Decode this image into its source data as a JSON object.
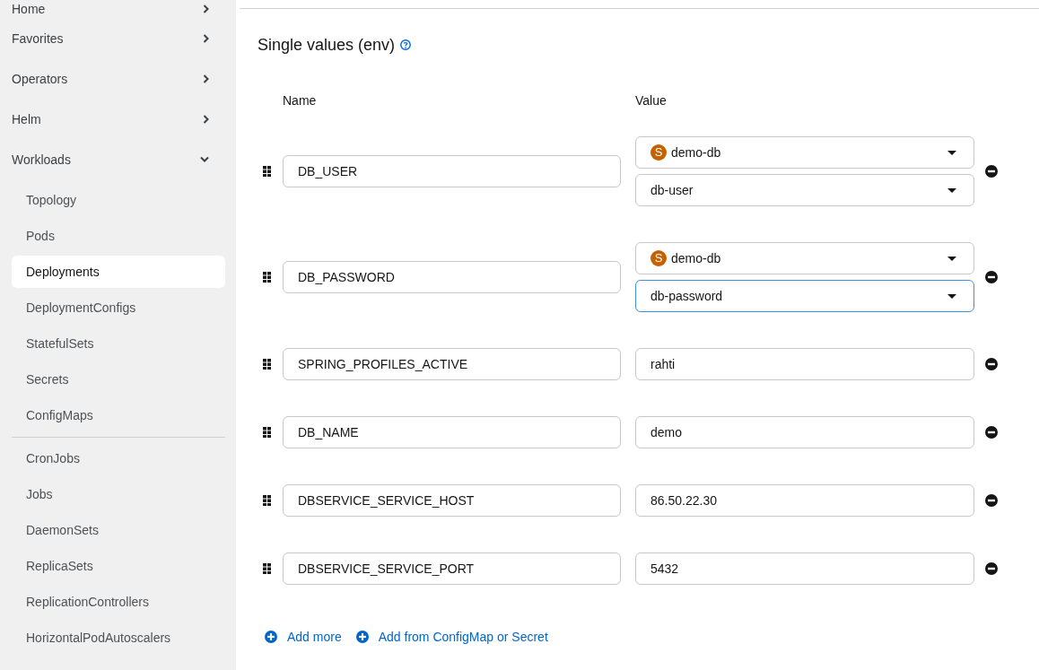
{
  "sidebar": {
    "items": [
      {
        "label": "Home",
        "expanded": false
      },
      {
        "label": "Favorites",
        "expanded": false
      },
      {
        "label": "Operators",
        "expanded": false
      },
      {
        "label": "Helm",
        "expanded": false
      },
      {
        "label": "Workloads",
        "expanded": true,
        "children": [
          {
            "kind": "link",
            "label": "Topology",
            "selected": false
          },
          {
            "kind": "link",
            "label": "Pods",
            "selected": false
          },
          {
            "kind": "link",
            "label": "Deployments",
            "selected": true
          },
          {
            "kind": "link",
            "label": "DeploymentConfigs",
            "selected": false
          },
          {
            "kind": "link",
            "label": "StatefulSets",
            "selected": false
          },
          {
            "kind": "link",
            "label": "Secrets",
            "selected": false
          },
          {
            "kind": "link",
            "label": "ConfigMaps",
            "selected": false
          },
          {
            "kind": "divider"
          },
          {
            "kind": "link",
            "label": "CronJobs",
            "selected": false
          },
          {
            "kind": "link",
            "label": "Jobs",
            "selected": false
          },
          {
            "kind": "link",
            "label": "DaemonSets",
            "selected": false
          },
          {
            "kind": "link",
            "label": "ReplicaSets",
            "selected": false
          },
          {
            "kind": "link",
            "label": "ReplicationControllers",
            "selected": false
          },
          {
            "kind": "link",
            "label": "HorizontalPodAutoscalers",
            "selected": false
          }
        ]
      }
    ]
  },
  "env_section": {
    "title": "Single values (env)",
    "columns": [
      "Name",
      "Value"
    ],
    "rows": [
      {
        "name": "DB_USER",
        "value": {
          "kind": "reference",
          "resource": {
            "badge": "S",
            "label": "demo-db",
            "focused": false
          },
          "key": {
            "label": "db-user",
            "focused": false
          }
        }
      },
      {
        "name": "DB_PASSWORD",
        "value": {
          "kind": "reference",
          "resource": {
            "badge": "S",
            "label": "demo-db",
            "focused": false
          },
          "key": {
            "label": "db-password",
            "focused": true
          }
        }
      },
      {
        "name": "SPRING_PROFILES_ACTIVE",
        "value": {
          "kind": "text",
          "text": "rahti"
        }
      },
      {
        "name": "DB_NAME",
        "value": {
          "kind": "text",
          "text": "demo"
        }
      },
      {
        "name": "DBSERVICE_SERVICE_HOST",
        "value": {
          "kind": "text",
          "text": "86.50.22.30"
        }
      },
      {
        "name": "DBSERVICE_SERVICE_PORT",
        "value": {
          "kind": "text",
          "text": "5432"
        }
      }
    ],
    "actions": [
      "Add more",
      "Add from ConfigMap or Secret"
    ]
  }
}
